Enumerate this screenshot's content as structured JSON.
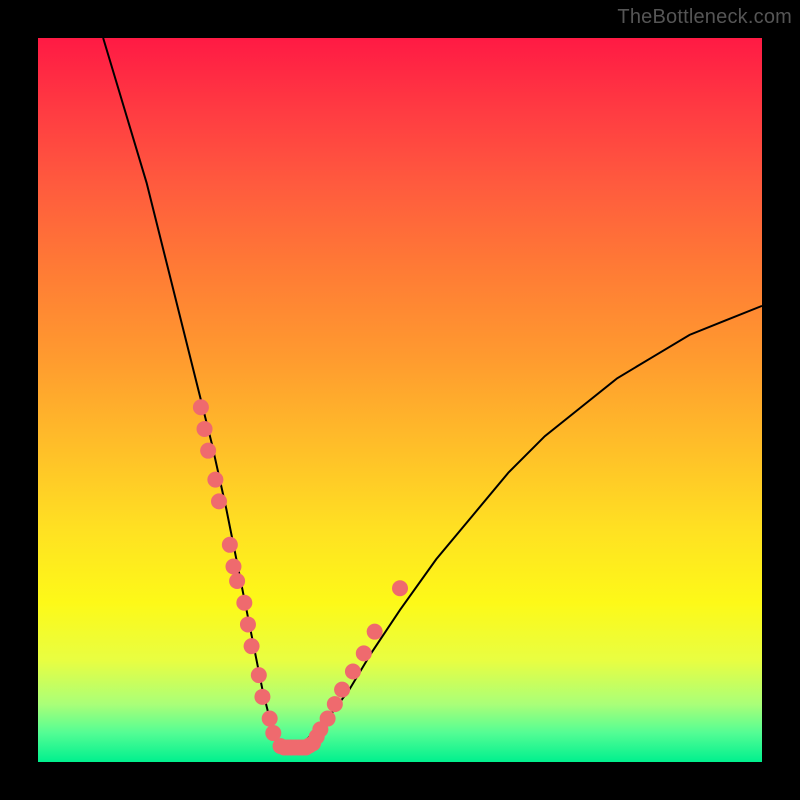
{
  "attribution": "TheBottleneck.com",
  "chart_data": {
    "type": "line",
    "title": "",
    "xlabel": "",
    "ylabel": "",
    "xlim": [
      0,
      100
    ],
    "ylim": [
      0,
      100
    ],
    "grid": false,
    "legend": false,
    "series": [
      {
        "name": "curve",
        "color": "#000000",
        "x": [
          9,
          12,
          15,
          18,
          20,
          22,
          24,
          26,
          27,
          28,
          29,
          30,
          31,
          32,
          33,
          34,
          35,
          37,
          40,
          43,
          46,
          50,
          55,
          60,
          65,
          70,
          75,
          80,
          85,
          90,
          95,
          100
        ],
        "y": [
          100,
          90,
          80,
          68,
          60,
          52,
          44,
          35,
          30,
          25,
          20,
          15,
          10,
          6,
          3,
          2,
          2,
          3,
          6,
          10,
          15,
          21,
          28,
          34,
          40,
          45,
          49,
          53,
          56,
          59,
          61,
          63
        ]
      }
    ],
    "scatter": [
      {
        "name": "points-left",
        "color": "#ef6a6e",
        "x": [
          22.5,
          23.0,
          23.5,
          24.5,
          25.0,
          26.5,
          27.0,
          27.5,
          28.5,
          29.0,
          29.5,
          30.5,
          31.0,
          32.0,
          32.5,
          33.5,
          34.0,
          34.5
        ],
        "y": [
          49.0,
          46.0,
          43.0,
          39.0,
          36.0,
          30.0,
          27.0,
          25.0,
          22.0,
          19.0,
          16.0,
          12.0,
          9.0,
          6.0,
          4.0,
          2.2,
          2.0,
          2.0
        ]
      },
      {
        "name": "points-bottom",
        "color": "#ef6a6e",
        "x": [
          35.0,
          35.5,
          36.0,
          36.5,
          37.0,
          37.5,
          38.0
        ],
        "y": [
          2.0,
          2.0,
          2.0,
          2.0,
          2.0,
          2.3,
          2.6
        ]
      },
      {
        "name": "points-right",
        "color": "#ef6a6e",
        "x": [
          38.5,
          39.0,
          40.0,
          41.0,
          42.0,
          43.5,
          45.0,
          46.5,
          50.0
        ],
        "y": [
          3.5,
          4.5,
          6.0,
          8.0,
          10.0,
          12.5,
          15.0,
          18.0,
          24.0
        ]
      }
    ]
  }
}
